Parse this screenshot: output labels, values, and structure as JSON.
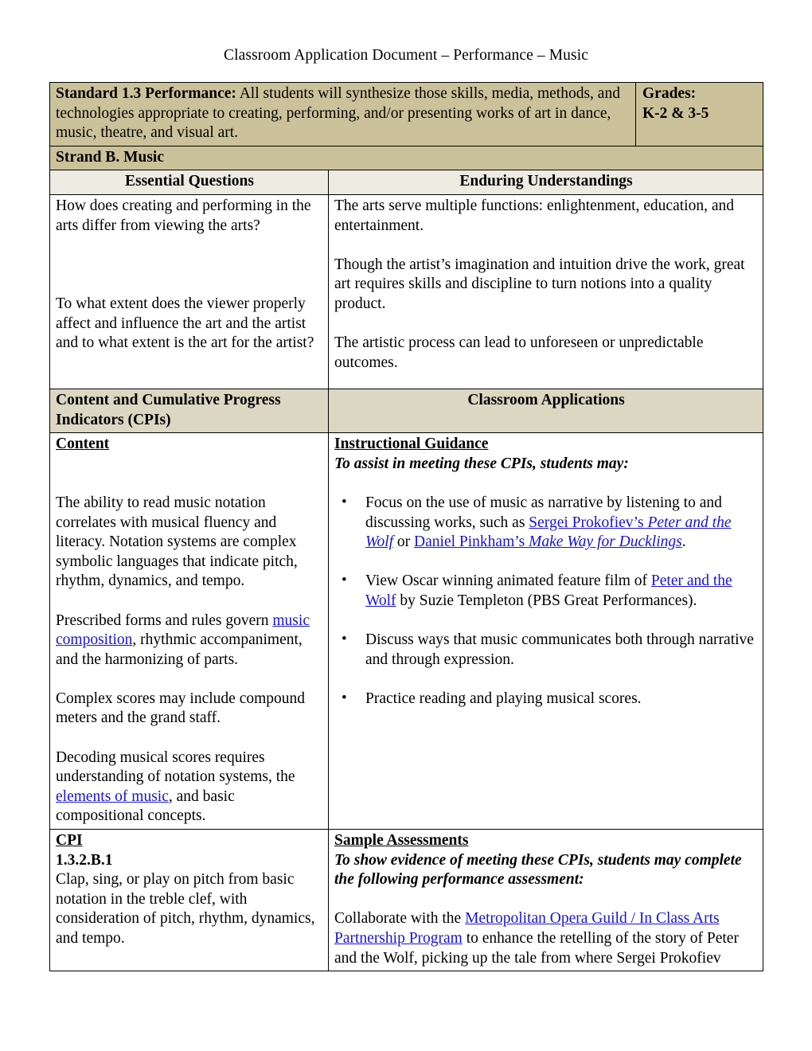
{
  "document": {
    "title": "Classroom Application Document – Performance – Music"
  },
  "standard": {
    "label": "Standard 1.3 Performance:",
    "text": " All students will synthesize those skills, media, methods, and technologies appropriate to creating, performing, and/or presenting works of art in dance, music, theatre, and visual art.",
    "grades_label": "Grades:",
    "grades_value": "K-2 & 3-5"
  },
  "strand": {
    "label": "Strand  B. Music"
  },
  "columns": {
    "essential_questions": "Essential Questions",
    "enduring_understandings": "Enduring Understandings",
    "content_cpi": "Content and Cumulative Progress Indicators (CPIs)",
    "classroom_applications": "Classroom Applications"
  },
  "essential_questions": {
    "q1": "How does creating and performing in the arts differ from viewing the arts?",
    "q2": "To what extent does the viewer properly affect and influence the art and the artist and to what extent is the art for the artist?"
  },
  "enduring_understandings": {
    "p1": "The arts serve multiple functions: enlightenment, education, and entertainment.",
    "p2": "Though the artist’s imagination and intuition drive the work, great art requires skills and discipline to turn notions into a quality product.",
    "p3": "The artistic process can lead to unforeseen or unpredictable outcomes."
  },
  "content": {
    "heading": "Content",
    "p1": "The ability to read music notation correlates with musical fluency and literacy. Notation systems are complex symbolic languages that indicate pitch, rhythm, dynamics, and tempo.",
    "p2_before": "Prescribed forms and rules govern ",
    "p2_link": "music composition",
    "p2_after": ", rhythmic accompaniment, and the harmonizing of parts.",
    "p3": "Complex scores may include compound meters and the grand staff.",
    "p4_before": "Decoding musical scores requires understanding of notation systems, the ",
    "p4_link": "elements of music",
    "p4_after": ", and basic compositional concepts."
  },
  "instructional_guidance": {
    "heading": "Instructional Guidance",
    "subheading": "To assist in meeting these CPIs, students may:",
    "bullets": [
      {
        "before": "Focus on the use of music as narrative by listening to and discussing works, such as ",
        "link1": "Sergei Prokofiev’s ",
        "link1_italic": "Peter and the Wolf",
        "mid": " or ",
        "link2": "Daniel Pinkham’s ",
        "link2_italic": "Make Way for Ducklings",
        "after": "."
      },
      {
        "before": "View Oscar winning animated feature film of ",
        "link1": "Peter and the Wolf",
        "after": " by Suzie Templeton (PBS Great Performances)."
      },
      {
        "before": "Discuss ways that music communicates both through narrative and through expression."
      },
      {
        "before": "Practice reading and playing musical scores."
      }
    ]
  },
  "cpi": {
    "heading": "CPI",
    "code": "1.3.2.B.1",
    "text": "Clap, sing, or play on pitch from basic notation in the treble clef, with consideration of pitch, rhythm, dynamics, and tempo."
  },
  "sample_assessments": {
    "heading": "Sample Assessments",
    "subheading": "To show evidence of meeting these CPIs, students may complete the following performance assessment:",
    "body_before": "Collaborate with the ",
    "body_link": "Metropolitan Opera Guild / In Class Arts Partnership Program",
    "body_after": "  to enhance the retelling of the story of Peter and the Wolf, picking up the tale from where Sergei Prokofiev"
  },
  "colors": {
    "header_khaki": "#cbc29b",
    "subheader_khaki": "#dcd7c3",
    "cream": "#edebe2",
    "link_blue": "#1a13d2",
    "border": "#000000"
  }
}
